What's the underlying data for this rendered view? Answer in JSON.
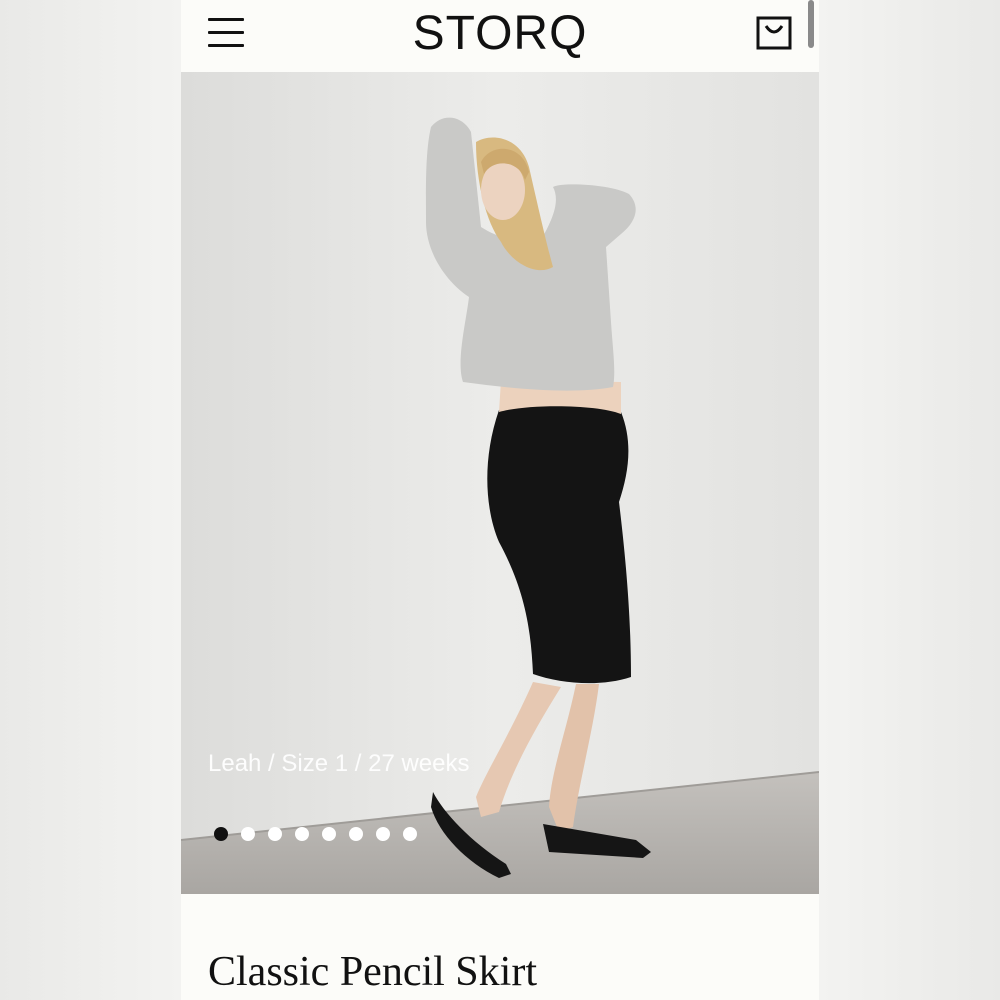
{
  "header": {
    "logo": "STORQ",
    "menu_icon": "hamburger-menu-icon",
    "cart_icon": "shopping-bag-icon"
  },
  "hero": {
    "caption": "Leah / Size 1 / 27 weeks",
    "dot_count": 8,
    "active_index": 0
  },
  "product": {
    "title": "Classic Pencil Skirt"
  },
  "colors": {
    "page_bg": "#fcfcf9",
    "text": "#111111",
    "photo_wall": "#e6e6e4",
    "photo_floor": "#b9b6b2"
  }
}
